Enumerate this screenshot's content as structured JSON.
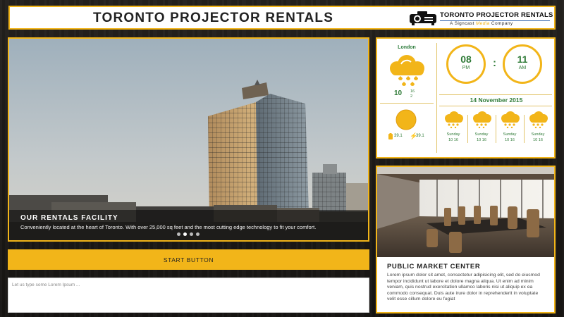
{
  "header": {
    "title": "TORONTO PROJECTOR RENTALS",
    "logo_title": "Toronto Projector Rentals",
    "logo_sub_prefix": "A Signcast",
    "logo_sub_accent": "Media",
    "logo_sub_suffix": "Company"
  },
  "hero": {
    "title": "OUR RENTALS FACILITY",
    "caption": "Conveniently located at the heart of Toronto. With over 25,000 sq feet and the most cutting edge technology to fit your comfort.",
    "slides_count": 4,
    "active_slide": 2
  },
  "start_button": {
    "label": "START BUTTON"
  },
  "message": {
    "placeholder": "Let us type some Lorem Ipsum ..."
  },
  "weather": {
    "city": "London",
    "current_temp": "10",
    "temp_high": "16",
    "temp_low": "2",
    "battery_value": "39.1",
    "power_value": "39.1",
    "clock": {
      "hour": "08",
      "hour_label": "PM",
      "minute": "11",
      "minute_label": "AM",
      "separator": ":"
    },
    "date": "14 November 2015",
    "forecast": [
      {
        "day": "Sunday",
        "range": "10  16"
      },
      {
        "day": "Sunday",
        "range": "10  16"
      },
      {
        "day": "Sunday",
        "range": "10  16"
      },
      {
        "day": "Sunday",
        "range": "10  16"
      }
    ],
    "colors": {
      "accent": "#f2b519",
      "text": "#2e7a36"
    }
  },
  "market": {
    "title": "PUBLIC MARKET CENTER",
    "body": "Lorem ipsum dolor sit amet, consectetur adipisicing elit, sed do eiusmod tempor incididunt ut labore et dolore magna aliqua. Ut enim ad minim veniam, quis nostrud exercitation ullamco laboris nisi ut aliquip ex ea commodo consequat. Duis aute irure dolor in reprehenderit in voluptate velit esse cillum dolore eu fugiat"
  },
  "colors": {
    "brand_gold": "#f2b519",
    "background_wood": "#1b1917"
  }
}
